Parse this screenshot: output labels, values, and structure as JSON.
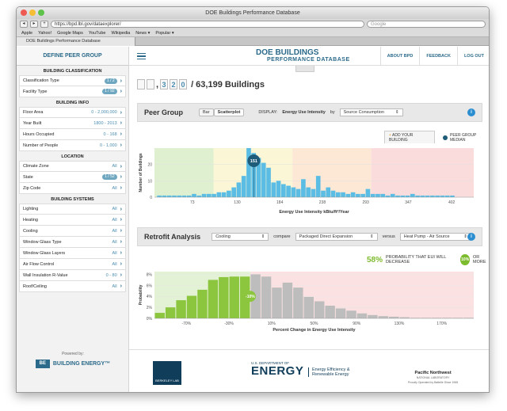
{
  "browser": {
    "title": "DOE Buildings Performance Database",
    "url": "https://bpd.lbl.gov/dataexplorer/",
    "search_placeholder": "Google",
    "bookmarks": [
      "Apple",
      "Yahoo!",
      "Google Maps",
      "YouTube",
      "Wikipedia",
      "News ▾",
      "Popular ▾"
    ],
    "tab_label": "DOE Buildings Performance Database"
  },
  "sidebar": {
    "heading": "DEFINE PEER GROUP",
    "sections": [
      {
        "title": "BUILDING CLASSIFICATION",
        "items": [
          {
            "label": "Classification Type",
            "value": "1 / 2",
            "pill": true
          },
          {
            "label": "Facility Type",
            "value": "1 / 92",
            "pill": true
          }
        ]
      },
      {
        "title": "BUILDING INFO",
        "items": [
          {
            "label": "Floor Area",
            "value": "0 - 2,000,000"
          },
          {
            "label": "Year Built",
            "value": "1800 - 2013"
          },
          {
            "label": "Hours Occupied",
            "value": "0 - 168"
          },
          {
            "label": "Number of People",
            "value": "0 - 1,000"
          }
        ]
      },
      {
        "title": "LOCATION",
        "items": [
          {
            "label": "Climate Zone",
            "value": "All"
          },
          {
            "label": "State",
            "value": "1 / 52",
            "pill": true
          },
          {
            "label": "Zip Code",
            "value": "All"
          }
        ]
      },
      {
        "title": "BUILDING SYSTEMS",
        "items": [
          {
            "label": "Lighting",
            "value": "All"
          },
          {
            "label": "Heating",
            "value": "All"
          },
          {
            "label": "Cooling",
            "value": "All"
          },
          {
            "label": "Window Glass Type",
            "value": "All"
          },
          {
            "label": "Window Glass Layers",
            "value": "All"
          },
          {
            "label": "Air Flow Control",
            "value": "All"
          },
          {
            "label": "Wall Insulation R-Value",
            "value": "0 - 80"
          },
          {
            "label": "Roof/Ceiling",
            "value": "All"
          }
        ]
      }
    ],
    "powered_by": "Powered by:",
    "powered_logo_mark": "BE",
    "powered_name": "BUILDING ENERGY™"
  },
  "header": {
    "logo_line1": "DOE BUILDINGS",
    "logo_line2": "PERFORMANCE DATABASE",
    "links": [
      "ABOUT BPD",
      "FEEDBACK",
      "LOG OUT"
    ]
  },
  "count": {
    "digits": [
      "",
      "",
      "3",
      "2",
      "0"
    ],
    "comma": ",",
    "total": "/ 63,199 Buildings"
  },
  "peer": {
    "title": "Peer Group",
    "buttons": [
      "Bar",
      "Scatterplot"
    ],
    "display_label": "DISPLAY:",
    "metric_label": "Energy Use Intensity",
    "by_label": "by",
    "source_select": "Source Consumption",
    "add_building": "ADD YOUR BUILDING",
    "median_legend": "PEER GROUP MEDIAN"
  },
  "retrofit": {
    "title": "Retrofit Analysis",
    "select1": "Cooling",
    "compare_label": "compare",
    "select2": "Packaged Direct Expansion",
    "versus_label": "versus",
    "select3": "Heat Pump - Air Source",
    "prob_pct": "58%",
    "prob_text": "PROBABILITY THAT EUI WILL DECREASE",
    "prob_badge": "10%",
    "prob_suffix": "OR MORE"
  },
  "colors": {
    "accent": "#2b6a8a",
    "bar_blue": "#5bbde4",
    "bar_green": "#8cc63f",
    "bar_gray": "#bdbdbd",
    "median": "#1f5c7a"
  },
  "chart_data": [
    {
      "type": "bar",
      "title": "",
      "xlabel": "Energy Use Intensity kBtu/ft²/Year",
      "ylabel": "Number of Buildings",
      "xticks": [
        73,
        130,
        184,
        238,
        293,
        347,
        402
      ],
      "yticks": [
        0,
        10,
        20
      ],
      "ylim": [
        0,
        30
      ],
      "xlim": [
        25,
        430
      ],
      "bin_start": 28,
      "bin_width": 6.3,
      "values": [
        1,
        1,
        1,
        1,
        1,
        1,
        1,
        2,
        1,
        2,
        2,
        2,
        3,
        3,
        4,
        6,
        9,
        13,
        30,
        27,
        24,
        21,
        18,
        9,
        10,
        8,
        7,
        6,
        5,
        11,
        6,
        5,
        13,
        4,
        6,
        4,
        3,
        3,
        2,
        3,
        2,
        2,
        5,
        2,
        2,
        2,
        1,
        2,
        1,
        1,
        1,
        2,
        1,
        1,
        1,
        1,
        1,
        1,
        1,
        1
      ],
      "median_label": "151",
      "median_x": 151
    },
    {
      "type": "bar",
      "title": "",
      "xlabel": "Percent Change in Energy Use Intensity",
      "ylabel": "Probability",
      "xticks": [
        "-70%",
        "-30%",
        "10%",
        "50%",
        "90%",
        "130%",
        "170%"
      ],
      "xtick_values": [
        -70,
        -30,
        10,
        50,
        90,
        130,
        170
      ],
      "yticks": [
        "0%",
        "2%",
        "4%",
        "6%",
        "8%"
      ],
      "ylim": [
        0,
        8.5
      ],
      "xlim": [
        -100,
        200
      ],
      "bin_start": -100,
      "bin_width": 10,
      "values": [
        1.0,
        2.0,
        3.3,
        4.1,
        5.2,
        7.0,
        7.5,
        7.6,
        7.6,
        8.0,
        7.6,
        5.6,
        6.5,
        5.6,
        3.9,
        3.1,
        2.3,
        1.8,
        1.4,
        0.9,
        0.6,
        0.4,
        0.3,
        0.2,
        0.1,
        0.1,
        0.1,
        0.1,
        0.1,
        0.1
      ],
      "marker_label": "-10%",
      "marker_x": -10
    }
  ],
  "footer": {
    "berkeley": "BERKELEY LAB",
    "doe_small": "U.S. DEPARTMENT OF",
    "doe_big": "ENERGY",
    "eere_line1": "Energy Efficiency &",
    "eere_line2": "Renewable Energy",
    "pnnl_line1": "Pacific Northwest",
    "pnnl_line2": "NATIONAL LABORATORY",
    "pnnl_line3": "Proudly Operated by Battelle Since 1965"
  }
}
